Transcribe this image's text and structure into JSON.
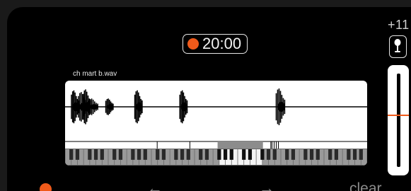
{
  "recorder": {
    "timer": "20:00",
    "filename": "ch mart b.wav",
    "level_label": "+11",
    "input_level": 0.56
  },
  "waveform": {
    "bursts": [
      {
        "center": 0.033,
        "peak": 0.9,
        "width": 0.012
      },
      {
        "center": 0.058,
        "peak": 0.8,
        "width": 0.014
      },
      {
        "center": 0.072,
        "peak": 0.95,
        "width": 0.012
      },
      {
        "center": 0.093,
        "peak": 0.45,
        "width": 0.015
      },
      {
        "center": 0.147,
        "peak": 0.45,
        "width": 0.012
      },
      {
        "center": 0.243,
        "peak": 0.9,
        "width": 0.012
      },
      {
        "center": 0.392,
        "peak": 0.9,
        "width": 0.012
      },
      {
        "center": 0.713,
        "peak": 1.0,
        "width": 0.014
      }
    ],
    "markers": [
      0.305,
      0.413,
      0.681,
      0.685,
      0.692,
      0.699,
      0.706
    ],
    "selection": [
      0.505,
      0.655
    ],
    "octaves": 7
  },
  "controls": {
    "back_arrow": "←",
    "forward_arrow": "→",
    "clear_label": "clear"
  },
  "icons": {
    "record": "record-icon",
    "microphone": "microphone-icon"
  },
  "colors": {
    "accent": "#f05a1a",
    "background": "#000000",
    "panel": "#ffffff",
    "muted_text": "#8a8a8a"
  }
}
